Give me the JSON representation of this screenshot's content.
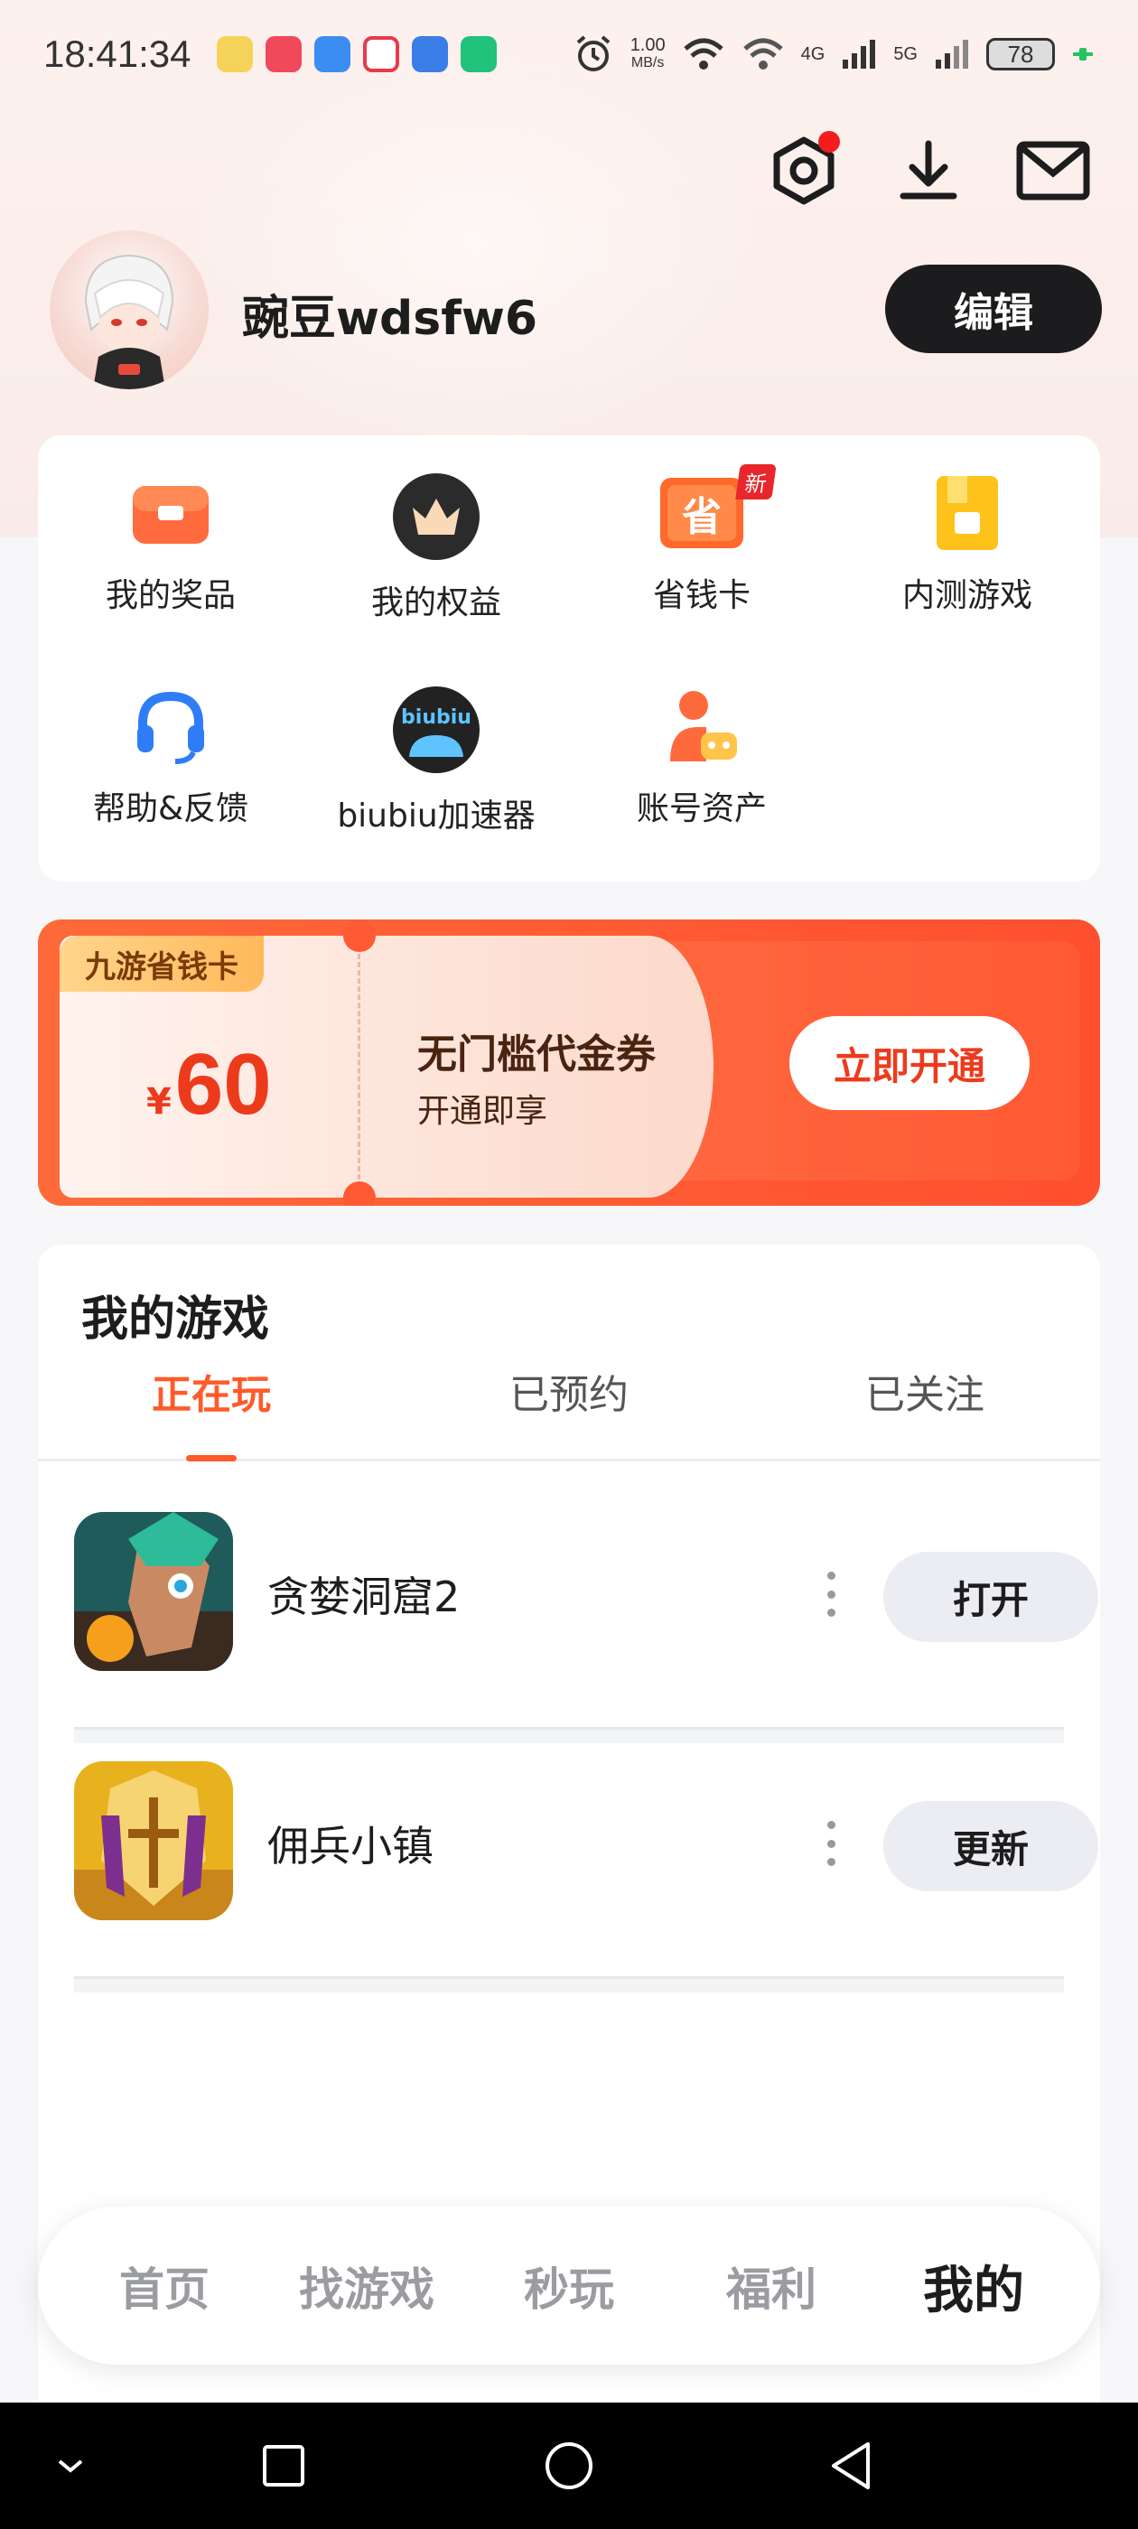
{
  "status_bar": {
    "time": "18:41:34",
    "speed_value": "1.00",
    "speed_unit": "MB/s",
    "net1": "4G",
    "net2": "5G",
    "battery": "78"
  },
  "profile": {
    "username": "豌豆wdsfw6",
    "edit_label": "编辑"
  },
  "grid": {
    "items": [
      {
        "label": "我的奖品"
      },
      {
        "label": "我的权益"
      },
      {
        "label": "省钱卡",
        "badge": "新"
      },
      {
        "label": "内测游戏"
      },
      {
        "label": "帮助&反馈"
      },
      {
        "label": "biubiu加速器",
        "icon_text": "biubiu"
      },
      {
        "label": "账号资产"
      }
    ],
    "sheng_glyph": "省"
  },
  "coupon": {
    "tag": "九游省钱卡",
    "currency": "¥",
    "amount": "60",
    "title": "无门槛代金券",
    "subtitle": "开通即享",
    "button": "立即开通"
  },
  "games": {
    "title": "我的游戏",
    "tabs": [
      "正在玩",
      "已预约",
      "已关注"
    ],
    "list": [
      {
        "name": "贪婪洞窟2",
        "action": "打开"
      },
      {
        "name": "佣兵小镇",
        "action": "更新"
      }
    ]
  },
  "bottom_nav": {
    "items": [
      "首页",
      "找游戏",
      "秒玩",
      "福利",
      "我的"
    ]
  },
  "colors": {
    "accent": "#ff5a2a",
    "dark": "#1c1c1e",
    "badge_red": "#e8262b"
  }
}
